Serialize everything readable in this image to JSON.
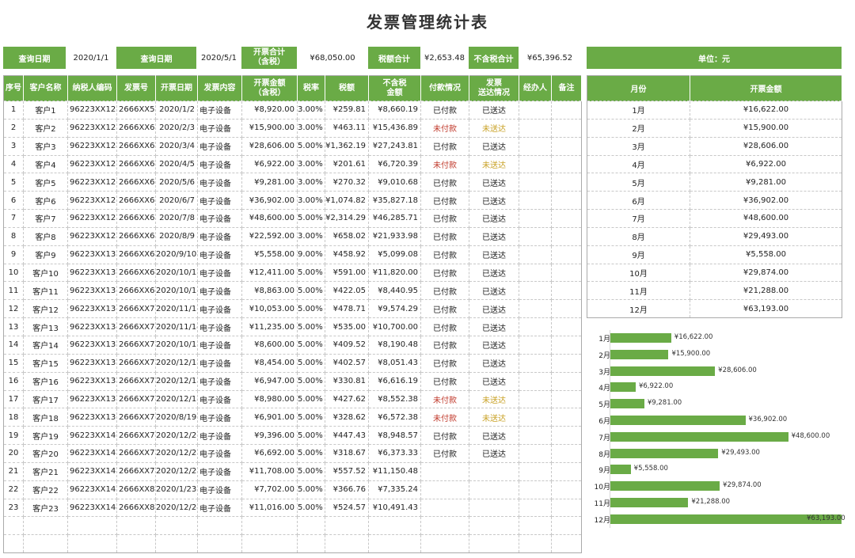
{
  "title": "发票管理统计表",
  "query": {
    "date_label_1": "查询日期",
    "date_value_1": "2020/1/1",
    "date_label_2": "查询日期",
    "date_value_2": "2020/5/1",
    "total_label": "开票合计\n（含税）",
    "total_value": "¥68,050.00",
    "tax_label": "税额合计",
    "tax_value": "¥2,653.48",
    "notax_label": "不含税合计",
    "notax_value": "¥65,396.52"
  },
  "unit_label": "单位：元",
  "columns": [
    "序号",
    "客户名称",
    "纳税人编码",
    "发票号",
    "开票日期",
    "发票内容",
    "开票金额\n（含税）",
    "税率",
    "税额",
    "不含税\n金额",
    "付款情况",
    "发票\n送达情况",
    "经办人",
    "备注"
  ],
  "rows": [
    [
      "1",
      "客户1",
      "96223XX122",
      "2666XX59",
      "2020/1/2",
      "电子设备",
      "¥8,920.00",
      "3.00%",
      "¥259.81",
      "¥8,660.19",
      "已付款",
      "已送达",
      "",
      ""
    ],
    [
      "2",
      "客户2",
      "96223XX123",
      "2666XX60",
      "2020/2/3",
      "电子设备",
      "¥15,900.00",
      "3.00%",
      "¥463.11",
      "¥15,436.89",
      "未付款",
      "未送达",
      "",
      ""
    ],
    [
      "3",
      "客户3",
      "96223XX124",
      "2666XX61",
      "2020/3/4",
      "电子设备",
      "¥28,606.00",
      "5.00%",
      "¥1,362.19",
      "¥27,243.81",
      "已付款",
      "已送达",
      "",
      ""
    ],
    [
      "4",
      "客户4",
      "96223XX125",
      "2666XX62",
      "2020/4/5",
      "电子设备",
      "¥6,922.00",
      "3.00%",
      "¥201.61",
      "¥6,720.39",
      "未付款",
      "未送达",
      "",
      ""
    ],
    [
      "5",
      "客户5",
      "96223XX126",
      "2666XX63",
      "2020/5/6",
      "电子设备",
      "¥9,281.00",
      "3.00%",
      "¥270.32",
      "¥9,010.68",
      "已付款",
      "已送达",
      "",
      ""
    ],
    [
      "6",
      "客户6",
      "96223XX127",
      "2666XX64",
      "2020/6/7",
      "电子设备",
      "¥36,902.00",
      "3.00%",
      "¥1,074.82",
      "¥35,827.18",
      "已付款",
      "已送达",
      "",
      ""
    ],
    [
      "7",
      "客户7",
      "96223XX128",
      "2666XX65",
      "2020/7/8",
      "电子设备",
      "¥48,600.00",
      "5.00%",
      "¥2,314.29",
      "¥46,285.71",
      "已付款",
      "已送达",
      "",
      ""
    ],
    [
      "8",
      "客户8",
      "96223XX129",
      "2666XX66",
      "2020/8/9",
      "电子设备",
      "¥22,592.00",
      "3.00%",
      "¥658.02",
      "¥21,933.98",
      "已付款",
      "已送达",
      "",
      ""
    ],
    [
      "9",
      "客户9",
      "96223XX130",
      "2666XX67",
      "2020/9/10",
      "电子设备",
      "¥5,558.00",
      "9.00%",
      "¥458.92",
      "¥5,099.08",
      "已付款",
      "已送达",
      "",
      ""
    ],
    [
      "10",
      "客户10",
      "96223XX131",
      "2666XX68",
      "2020/10/11",
      "电子设备",
      "¥12,411.00",
      "5.00%",
      "¥591.00",
      "¥11,820.00",
      "已付款",
      "已送达",
      "",
      ""
    ],
    [
      "11",
      "客户11",
      "96223XX132",
      "2666XX69",
      "2020/10/12",
      "电子设备",
      "¥8,863.00",
      "5.00%",
      "¥422.05",
      "¥8,440.95",
      "已付款",
      "已送达",
      "",
      ""
    ],
    [
      "12",
      "客户12",
      "96223XX133",
      "2666XX70",
      "2020/11/13",
      "电子设备",
      "¥10,053.00",
      "5.00%",
      "¥478.71",
      "¥9,574.29",
      "已付款",
      "已送达",
      "",
      ""
    ],
    [
      "13",
      "客户13",
      "96223XX134",
      "2666XX71",
      "2020/11/14",
      "电子设备",
      "¥11,235.00",
      "5.00%",
      "¥535.00",
      "¥10,700.00",
      "已付款",
      "已送达",
      "",
      ""
    ],
    [
      "14",
      "客户14",
      "96223XX135",
      "2666XX72",
      "2020/10/15",
      "电子设备",
      "¥8,600.00",
      "5.00%",
      "¥409.52",
      "¥8,190.48",
      "已付款",
      "已送达",
      "",
      ""
    ],
    [
      "15",
      "客户15",
      "96223XX136",
      "2666XX73",
      "2020/12/16",
      "电子设备",
      "¥8,454.00",
      "5.00%",
      "¥402.57",
      "¥8,051.43",
      "已付款",
      "已送达",
      "",
      ""
    ],
    [
      "16",
      "客户16",
      "96223XX137",
      "2666XX74",
      "2020/12/17",
      "电子设备",
      "¥6,947.00",
      "5.00%",
      "¥330.81",
      "¥6,616.19",
      "已付款",
      "已送达",
      "",
      ""
    ],
    [
      "17",
      "客户17",
      "96223XX138",
      "2666XX75",
      "2020/12/18",
      "电子设备",
      "¥8,980.00",
      "5.00%",
      "¥427.62",
      "¥8,552.38",
      "未付款",
      "未送达",
      "",
      ""
    ],
    [
      "18",
      "客户18",
      "96223XX139",
      "2666XX76",
      "2020/8/19",
      "电子设备",
      "¥6,901.00",
      "5.00%",
      "¥328.62",
      "¥6,572.38",
      "未付款",
      "未送达",
      "",
      ""
    ],
    [
      "19",
      "客户19",
      "96223XX140",
      "2666XX77",
      "2020/12/20",
      "电子设备",
      "¥9,396.00",
      "5.00%",
      "¥447.43",
      "¥8,948.57",
      "已付款",
      "已送达",
      "",
      ""
    ],
    [
      "20",
      "客户20",
      "96223XX141",
      "2666XX78",
      "2020/12/21",
      "电子设备",
      "¥6,692.00",
      "5.00%",
      "¥318.67",
      "¥6,373.33",
      "已付款",
      "已送达",
      "",
      ""
    ],
    [
      "21",
      "客户21",
      "96223XX142",
      "2666XX79",
      "2020/12/22",
      "电子设备",
      "¥11,708.00",
      "5.00%",
      "¥557.52",
      "¥11,150.48",
      "",
      "",
      "",
      ""
    ],
    [
      "22",
      "客户22",
      "96223XX143",
      "2666XX80",
      "2020/1/23",
      "电子设备",
      "¥7,702.00",
      "5.00%",
      "¥366.76",
      "¥7,335.24",
      "",
      "",
      "",
      ""
    ],
    [
      "23",
      "客户23",
      "96223XX144",
      "2666XX81",
      "2020/12/24",
      "电子设备",
      "¥11,016.00",
      "5.00%",
      "¥524.57",
      "¥10,491.43",
      "",
      "",
      "",
      ""
    ],
    [
      "",
      "",
      "",
      "",
      "",
      "",
      "",
      "",
      "",
      "",
      "",
      "",
      "",
      ""
    ],
    [
      "",
      "",
      "",
      "",
      "",
      "",
      "",
      "",
      "",
      "",
      "",
      "",
      "",
      ""
    ]
  ],
  "month_table": {
    "headers": [
      "月份",
      "开票金额"
    ],
    "rows": [
      [
        "1月",
        "¥16,622.00"
      ],
      [
        "2月",
        "¥15,900.00"
      ],
      [
        "3月",
        "¥28,606.00"
      ],
      [
        "4月",
        "¥6,922.00"
      ],
      [
        "5月",
        "¥9,281.00"
      ],
      [
        "6月",
        "¥36,902.00"
      ],
      [
        "7月",
        "¥48,600.00"
      ],
      [
        "8月",
        "¥29,493.00"
      ],
      [
        "9月",
        "¥5,558.00"
      ],
      [
        "10月",
        "¥29,874.00"
      ],
      [
        "11月",
        "¥21,288.00"
      ],
      [
        "12月",
        "¥63,193.00"
      ]
    ]
  },
  "chart_data": {
    "type": "bar",
    "orientation": "horizontal",
    "categories": [
      "1月",
      "2月",
      "3月",
      "4月",
      "5月",
      "6月",
      "7月",
      "8月",
      "9月",
      "10月",
      "11月",
      "12月"
    ],
    "values": [
      16622,
      15900,
      28606,
      6922,
      9281,
      36902,
      48600,
      29493,
      5558,
      29874,
      21288,
      63193
    ],
    "value_labels": [
      "¥16,622.00",
      "¥15,900.00",
      "¥28,606.00",
      "¥6,922.00",
      "¥9,281.00",
      "¥36,902.00",
      "¥48,600.00",
      "¥29,493.00",
      "¥5,558.00",
      "¥29,874.00",
      "¥21,288.00",
      "¥63,193.00"
    ],
    "colors": {
      "bar": "#6aab46"
    },
    "grid": false,
    "legend": "none"
  },
  "colors": {
    "accent": "#6aab46",
    "unpaid": "#c0392b",
    "undelivered": "#c9a227"
  }
}
